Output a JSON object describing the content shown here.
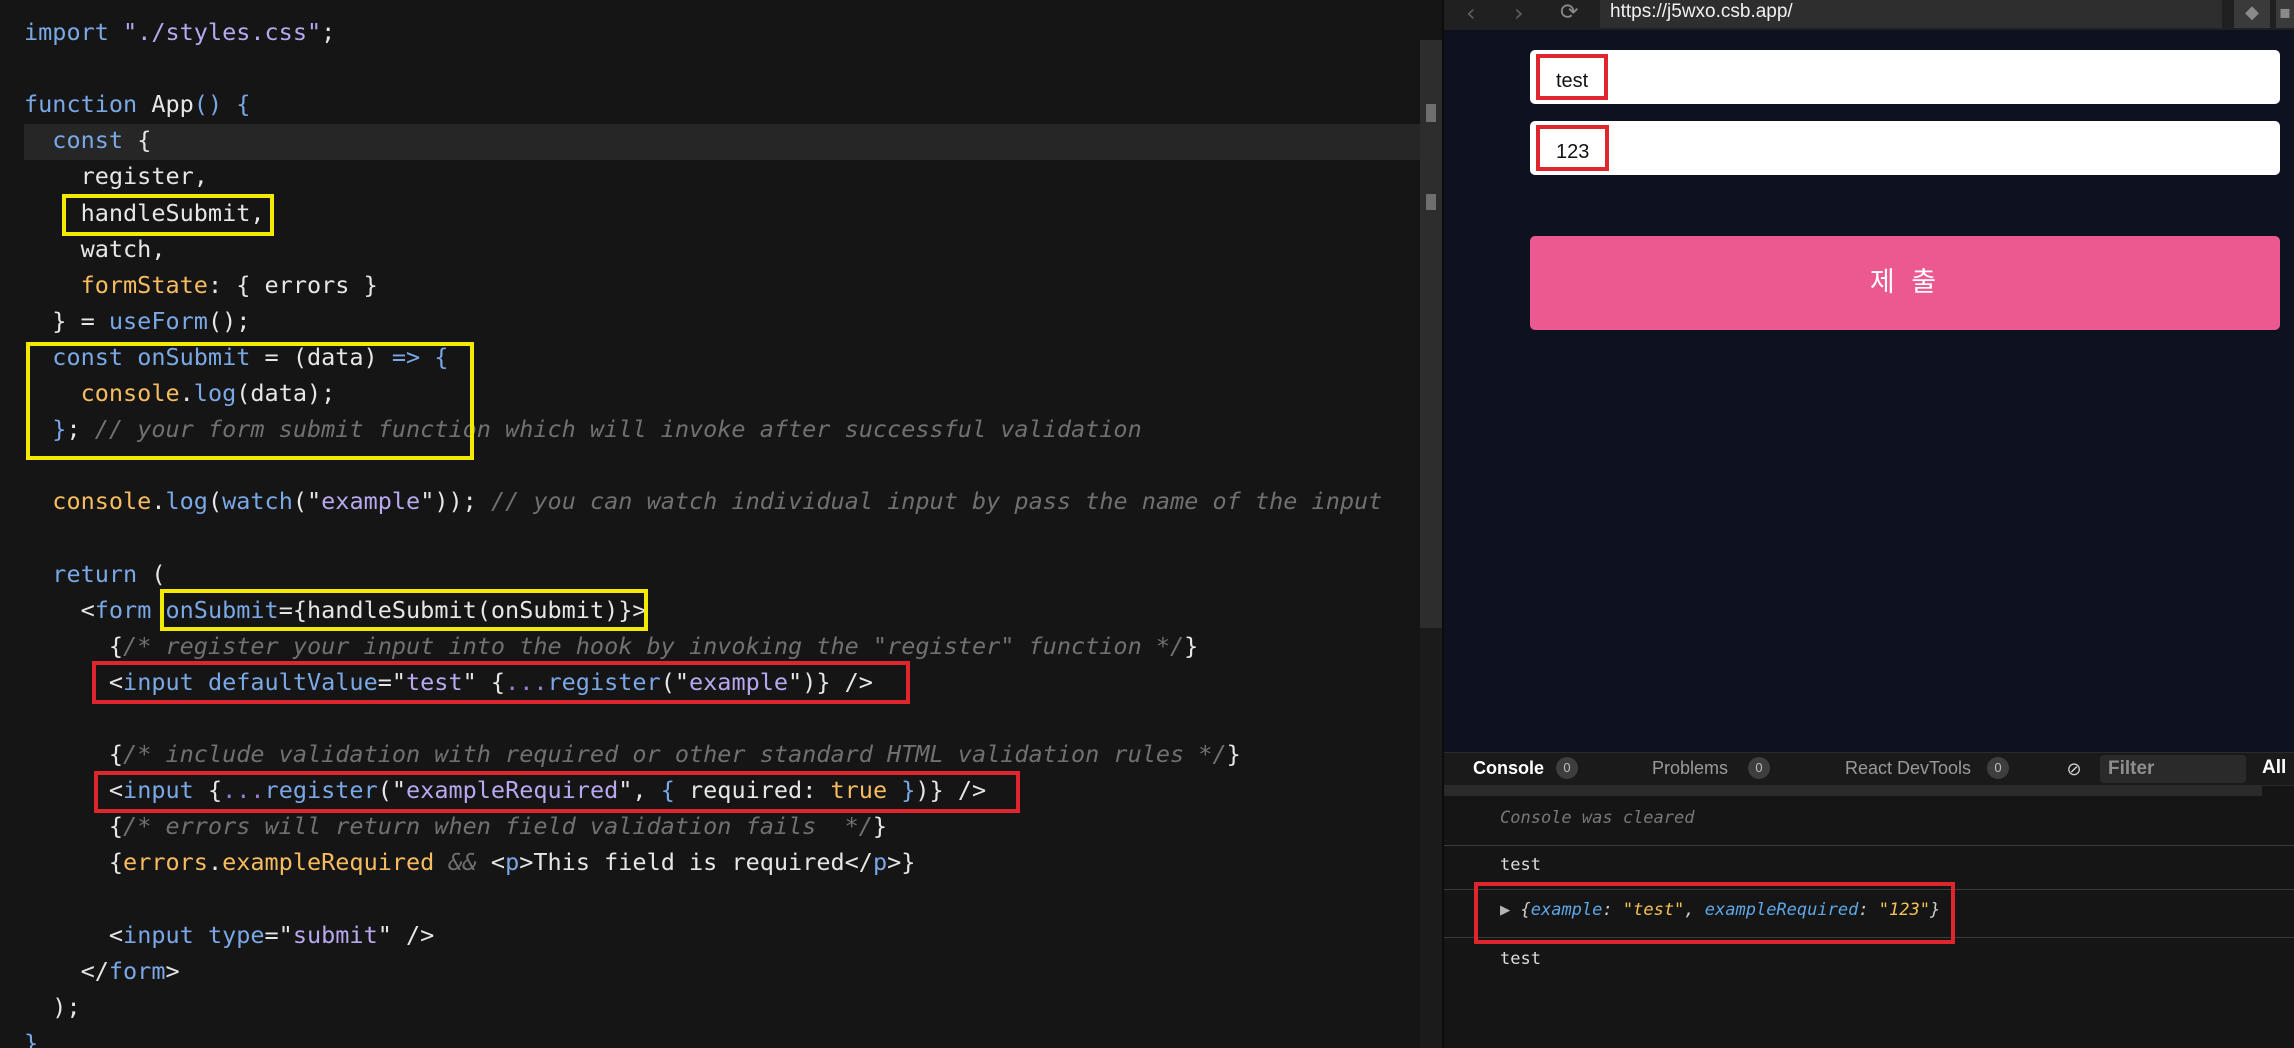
{
  "editor": {
    "lines": [
      {
        "tokens": [
          [
            "k",
            "import "
          ],
          [
            "s",
            "\"./styles.css\""
          ],
          [
            "d",
            ";"
          ]
        ]
      },
      {
        "tokens": []
      },
      {
        "tokens": [
          [
            "k",
            "function "
          ],
          [
            "d",
            "App"
          ],
          [
            "k",
            "() {"
          ]
        ]
      },
      {
        "tokens": [
          [
            "k",
            "  const "
          ],
          [
            "d",
            "{"
          ]
        ]
      },
      {
        "tokens": [
          [
            "d",
            "    register,"
          ]
        ]
      },
      {
        "tokens": [
          [
            "d",
            "    handleSubmit,"
          ]
        ]
      },
      {
        "tokens": [
          [
            "d",
            "    watch,"
          ]
        ]
      },
      {
        "tokens": [
          [
            "p",
            "    formState"
          ],
          [
            "d",
            ": { errors }"
          ]
        ]
      },
      {
        "tokens": [
          [
            "d",
            "  } = "
          ],
          [
            "k",
            "useForm"
          ],
          [
            "d",
            "();"
          ]
        ]
      },
      {
        "tokens": [
          [
            "k",
            "  const "
          ],
          [
            "k",
            "onSubmit"
          ],
          [
            "d",
            " = (data) "
          ],
          [
            "k",
            "=> {"
          ]
        ]
      },
      {
        "tokens": [
          [
            "p",
            "    console"
          ],
          [
            "d",
            "."
          ],
          [
            "k",
            "log"
          ],
          [
            "d",
            "(data);"
          ]
        ]
      },
      {
        "tokens": [
          [
            "k",
            "  }"
          ],
          [
            "d",
            "; "
          ],
          [
            "c",
            "// your form submit function which will invoke after successful validation"
          ]
        ]
      },
      {
        "tokens": []
      },
      {
        "tokens": [
          [
            "p",
            "  console"
          ],
          [
            "d",
            "."
          ],
          [
            "k",
            "log"
          ],
          [
            "d",
            "("
          ],
          [
            "k",
            "watch"
          ],
          [
            "d",
            "(\""
          ],
          [
            "s",
            "example"
          ],
          [
            "d",
            "\")); "
          ],
          [
            "c",
            "// you can watch individual input by pass the name of the input"
          ]
        ]
      },
      {
        "tokens": []
      },
      {
        "tokens": [
          [
            "k",
            "  return "
          ],
          [
            "d",
            "("
          ]
        ]
      },
      {
        "tokens": [
          [
            "d",
            "    <"
          ],
          [
            "k",
            "form "
          ],
          [
            "k",
            "onSubmit"
          ],
          [
            "d",
            "={handleSubmit(onSubmit)}>"
          ]
        ]
      },
      {
        "tokens": [
          [
            "d",
            "      {"
          ],
          [
            "c",
            "/* register your input into the hook by invoking the \"register\" function */"
          ],
          [
            "d",
            "}"
          ]
        ]
      },
      {
        "tokens": [
          [
            "d",
            "      <"
          ],
          [
            "k",
            "input "
          ],
          [
            "k",
            "defaultValue"
          ],
          [
            "d",
            "=\""
          ],
          [
            "s",
            "test"
          ],
          [
            "d",
            "\" {"
          ],
          [
            "pu",
            "..."
          ],
          [
            "k",
            "register"
          ],
          [
            "d",
            "(\""
          ],
          [
            "s",
            "example"
          ],
          [
            "d",
            "\")} />"
          ]
        ]
      },
      {
        "tokens": []
      },
      {
        "tokens": [
          [
            "d",
            "      {"
          ],
          [
            "c",
            "/* include validation with required or other standard HTML validation rules */"
          ],
          [
            "d",
            "}"
          ]
        ]
      },
      {
        "tokens": [
          [
            "d",
            "      <"
          ],
          [
            "k",
            "input "
          ],
          [
            "d",
            "{"
          ],
          [
            "pu",
            "..."
          ],
          [
            "k",
            "register"
          ],
          [
            "d",
            "(\""
          ],
          [
            "s",
            "exampleRequired"
          ],
          [
            "d",
            "\", "
          ],
          [
            "k",
            "{ "
          ],
          [
            "d",
            "required: "
          ],
          [
            "p",
            "true "
          ],
          [
            "k",
            "}"
          ],
          [
            "d",
            ")} />"
          ]
        ]
      },
      {
        "tokens": [
          [
            "d",
            "      {"
          ],
          [
            "c",
            "/* errors will return when field validation fails  */"
          ],
          [
            "d",
            "}"
          ]
        ]
      },
      {
        "tokens": [
          [
            "d",
            "      {"
          ],
          [
            "p",
            "errors"
          ],
          [
            "d",
            "."
          ],
          [
            "p",
            "exampleRequired "
          ],
          [
            "c",
            "&& "
          ],
          [
            "d",
            "<"
          ],
          [
            "k",
            "p"
          ],
          [
            "d",
            ">This field is required</"
          ],
          [
            "k",
            "p"
          ],
          [
            "d",
            ">}"
          ]
        ]
      },
      {
        "tokens": []
      },
      {
        "tokens": [
          [
            "d",
            "      <"
          ],
          [
            "k",
            "input "
          ],
          [
            "k",
            "type"
          ],
          [
            "d",
            "=\""
          ],
          [
            "s",
            "submit"
          ],
          [
            "d",
            "\" />"
          ]
        ]
      },
      {
        "tokens": [
          [
            "d",
            "    </"
          ],
          [
            "k",
            "form"
          ],
          [
            "d",
            ">"
          ]
        ]
      },
      {
        "tokens": [
          [
            "d",
            "  );"
          ]
        ]
      },
      {
        "tokens": [
          [
            "k",
            "}"
          ]
        ]
      }
    ]
  },
  "browser": {
    "back_icon": "chevron-left-icon",
    "forward_icon": "chevron-right-icon",
    "refresh_icon": "refresh-icon",
    "url": "https://j5wxo.csb.app/"
  },
  "preview": {
    "inputs": [
      {
        "value": "test"
      },
      {
        "value": "123"
      }
    ],
    "submit_label": "제 출",
    "accent": "#ec5990",
    "background": "#0e1120"
  },
  "console": {
    "tabs": [
      {
        "label": "Console",
        "count": "0"
      },
      {
        "label": "Problems",
        "count": "0"
      },
      {
        "label": "React DevTools",
        "count": "0"
      }
    ],
    "filter_placeholder": "Filter",
    "level": "All",
    "cleared_text": "Console was cleared",
    "logs": [
      "test",
      "test"
    ],
    "object_entry": {
      "k1": "example",
      "v1": "\"test\"",
      "k2": "exampleRequired",
      "v2": "\"123\""
    }
  },
  "markers": {
    "yellow": "#f2ea00",
    "red": "#e0262d"
  }
}
